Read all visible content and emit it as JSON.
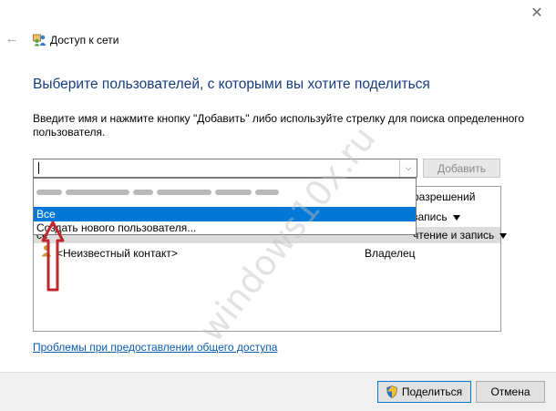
{
  "window": {
    "title": "Доступ к сети",
    "close_glyph": "✕",
    "back_glyph": "←"
  },
  "main": {
    "heading": "Выберите пользователей, с которыми вы хотите поделиться",
    "instruction": "Введите имя и нажмите кнопку \"Добавить\" либо используйте стрелку для поиска определенного пользователя."
  },
  "combo": {
    "value": "",
    "add_button": "Добавить",
    "dropdown_glyph": "⌵"
  },
  "dropdown": {
    "items": [
      {
        "label": "Все"
      },
      {
        "label": "Создать нового пользователя..."
      }
    ]
  },
  "table": {
    "header_permission": "разрешений",
    "rows": [
      {
        "name": "",
        "permission": "запись"
      },
      {
        "name": "се",
        "permission": "чтение и запись"
      },
      {
        "name": "<Неизвестный контакт>",
        "permission": "Владелец"
      }
    ]
  },
  "links": {
    "trouble": "Проблемы при предоставлении общего доступа"
  },
  "footer": {
    "share_button": "Поделиться",
    "cancel_button": "Отмена"
  },
  "watermark": "windows10x.ru",
  "colors": {
    "accent": "#0078d7",
    "heading": "#163d7d",
    "link": "#0b5cad",
    "arrow": "#c0272d"
  }
}
